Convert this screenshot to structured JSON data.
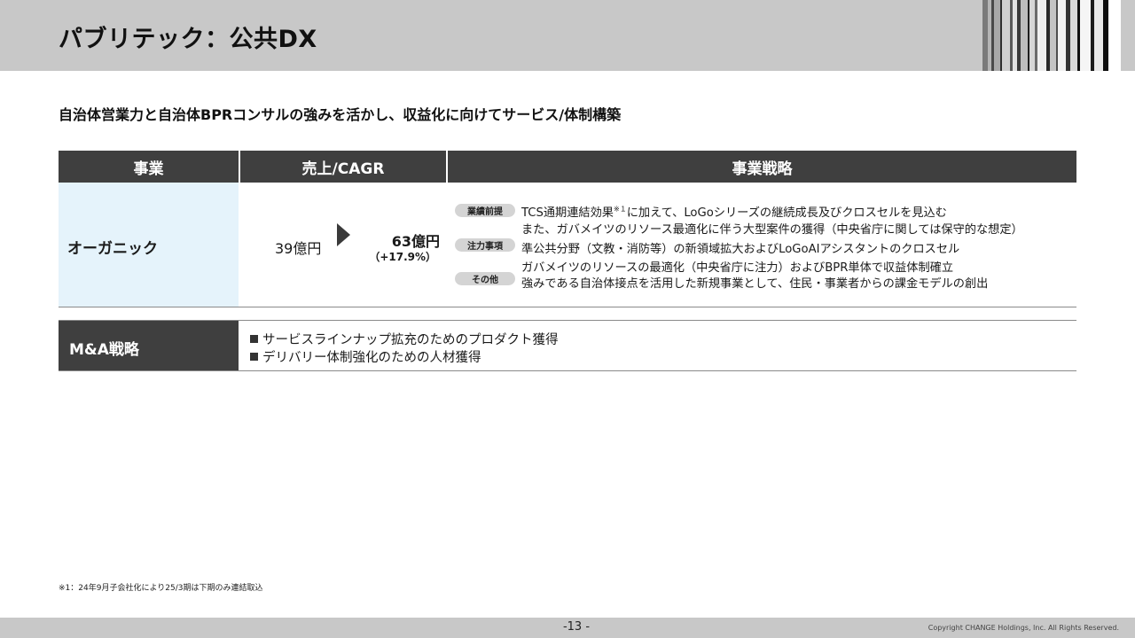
{
  "header": {
    "title": "パブリテック：公共DX"
  },
  "subtitle": "自治体営業力と自治体BPRコンサルの強みを活かし、収益化に向けてサービス/体制構築",
  "table": {
    "headers": [
      "事業",
      "売上/CAGR",
      "事業戦略"
    ],
    "organic": {
      "label": "オーガニック",
      "sales_from": "39億円",
      "sales_to": "63億円",
      "cagr": "（+17.9%）",
      "tags": [
        "業績前提",
        "注力事項",
        "その他"
      ],
      "lines": [
        "TCS通期連結効果",
        "に加えて、LoGoシリーズの継続成長及びクロスセルを見込む",
        "また、ガバメイツのリソース最適化に伴う大型案件の獲得（中央省庁に関しては保守的な想定）",
        "準公共分野（文教・消防等）の新領域拡大およびLoGoAIアシスタントのクロスセル",
        "ガバメイツのリソースの最適化（中央省庁に注力）およびBPR単体で収益体制確立",
        "強みである自治体接点を活用した新規事業として、住民・事業者からの課金モデルの創出"
      ],
      "footnote_ref": "※１"
    },
    "ma": {
      "label": "M&A戦略",
      "items": [
        "サービスラインナップ拡充のためのプロダクト獲得",
        "デリバリー体制強化のための人材獲得"
      ]
    }
  },
  "footnote": "※1：24年9月子会社化により25/3期は下期のみ連結取込",
  "footer": {
    "page": "-13 -",
    "copyright": "Copyright CHANGE Holdings, Inc. All Rights Reserved."
  },
  "colors": {
    "header_bg": "#c8c8c8",
    "table_header_bg": "#3f3f3f",
    "organic_bg": "#e5f3fb",
    "pill_bg": "#d4d4d4"
  }
}
